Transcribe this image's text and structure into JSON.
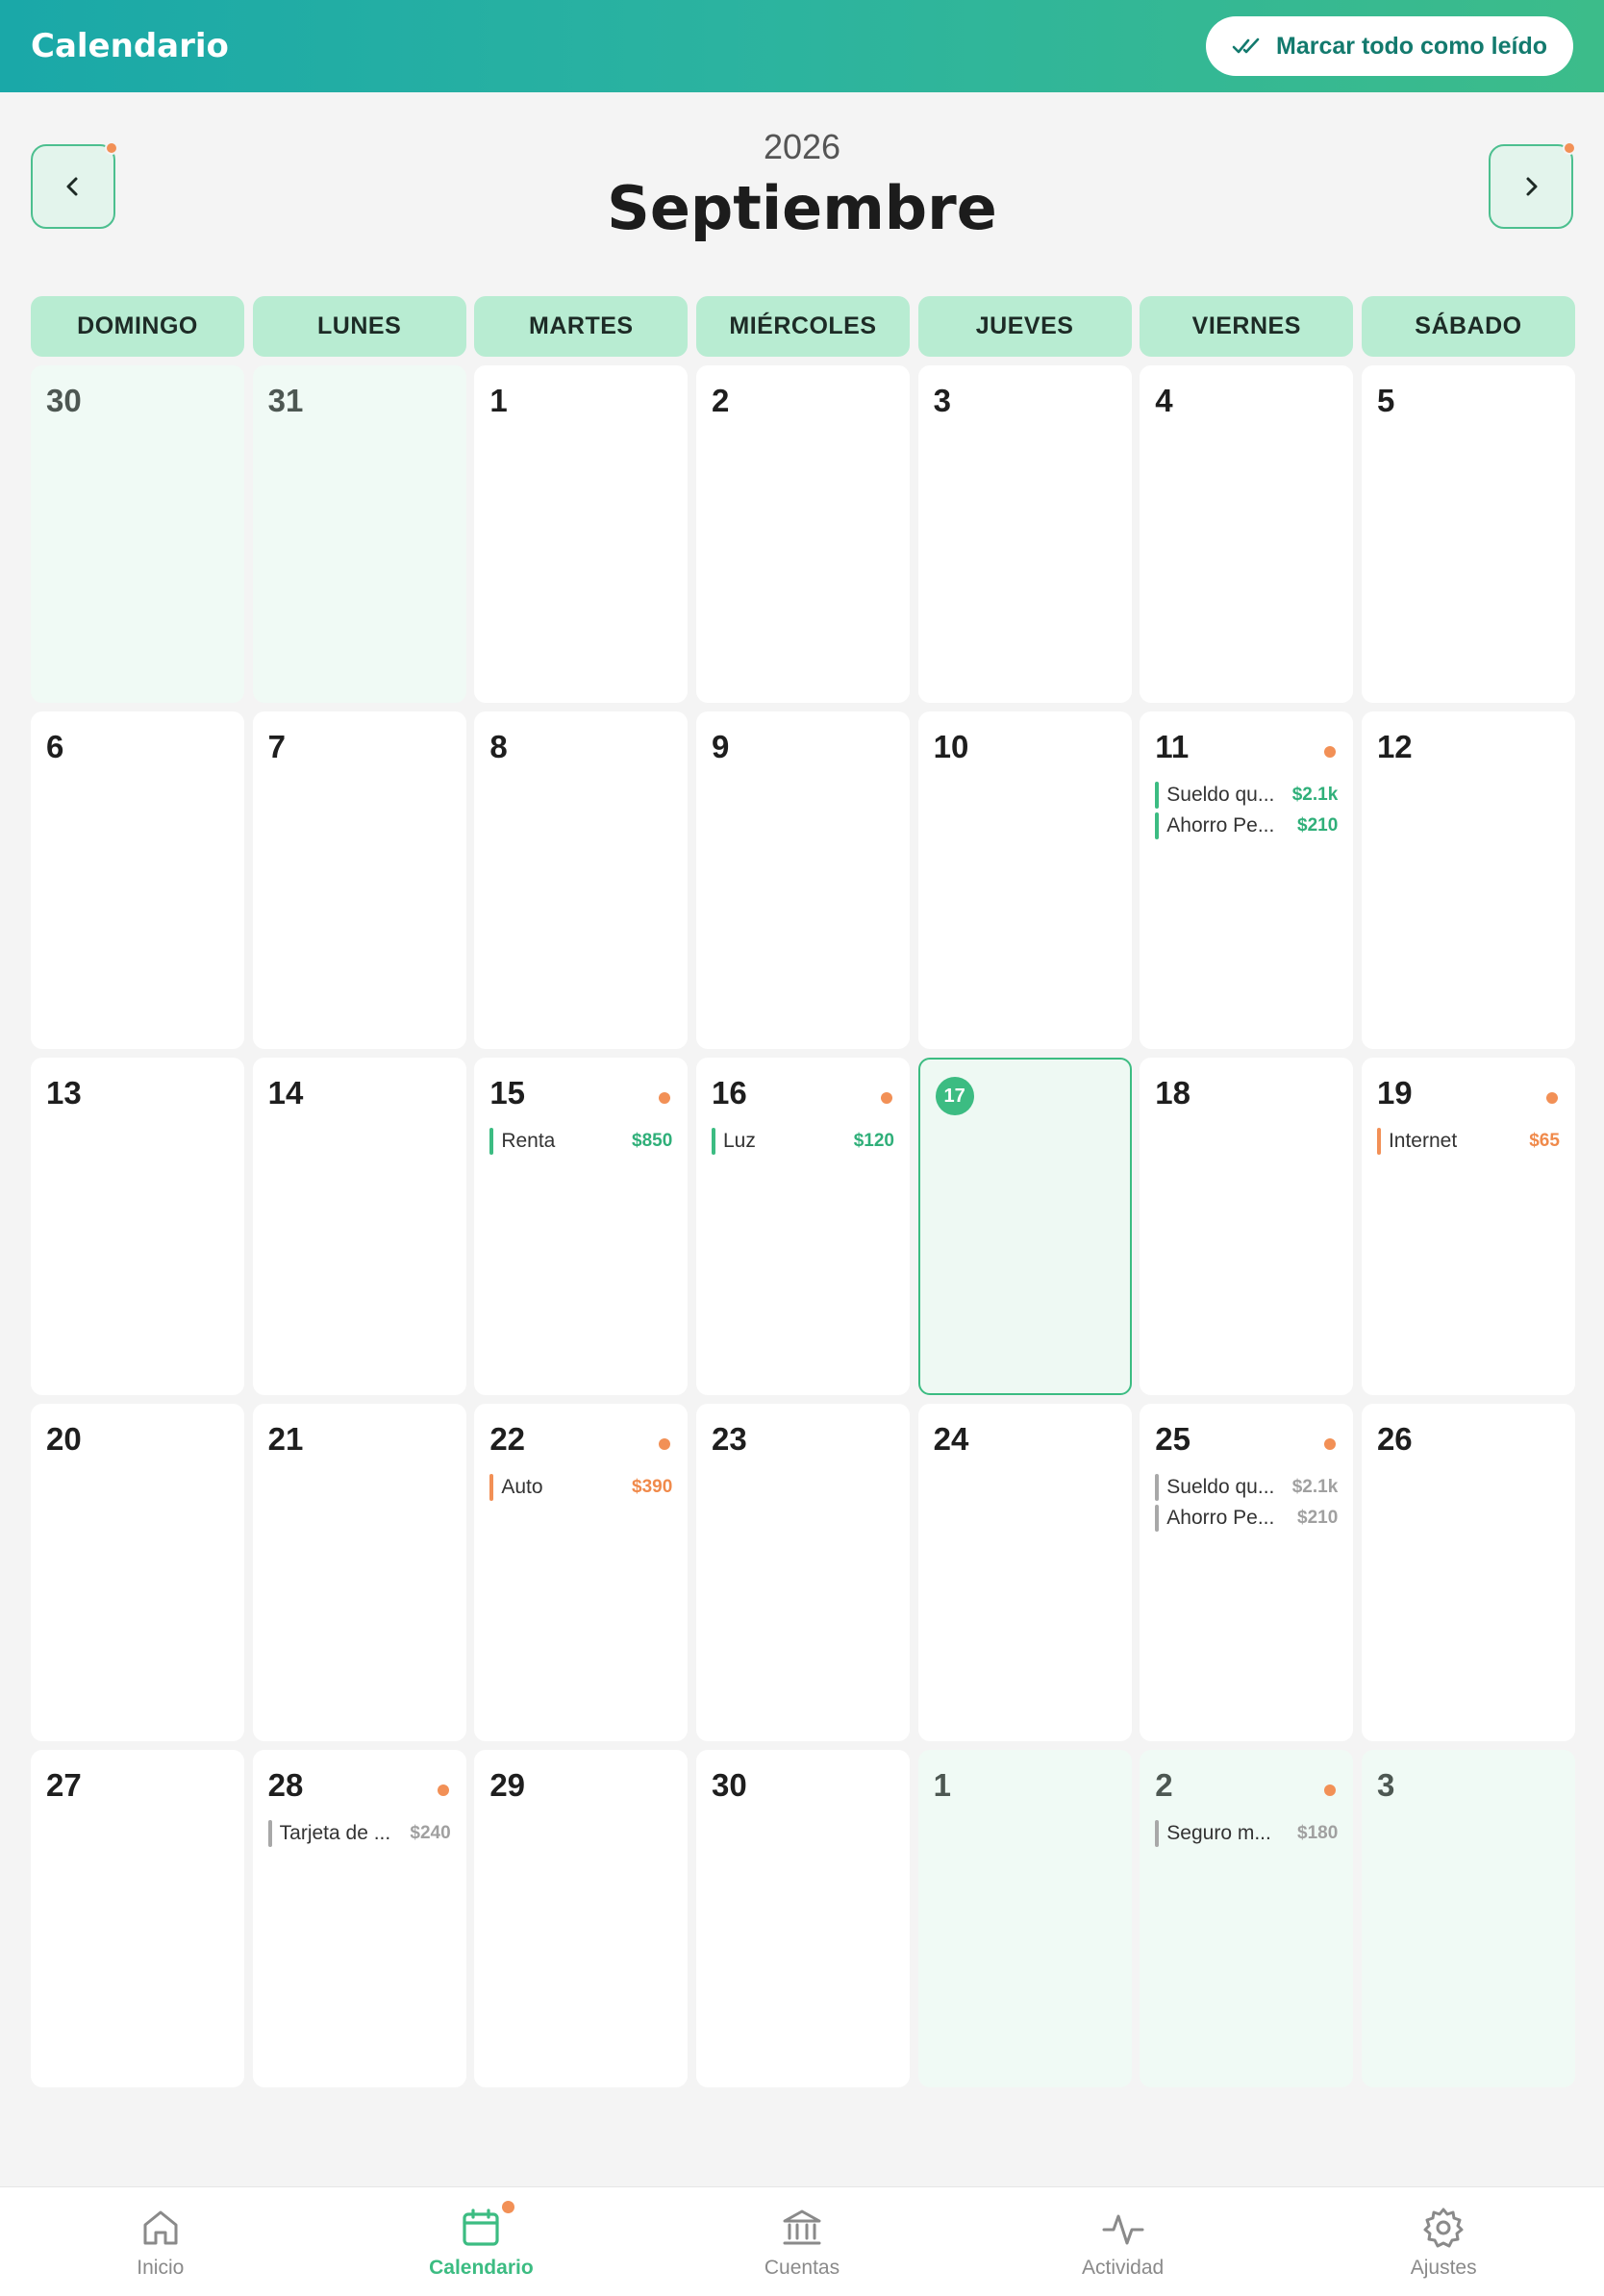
{
  "header": {
    "title": "Calendario",
    "mark_all_read": "Marcar todo como leído"
  },
  "month_nav": {
    "year": "2026",
    "month": "Septiembre",
    "prev_icon": "chevron-left-icon",
    "next_icon": "chevron-right-icon"
  },
  "weekdays": [
    "DOMINGO",
    "LUNES",
    "MARTES",
    "MIÉRCOLES",
    "JUEVES",
    "VIERNES",
    "SÁBADO"
  ],
  "days": [
    {
      "day": "30",
      "out": true
    },
    {
      "day": "31",
      "out": true
    },
    {
      "day": "1"
    },
    {
      "day": "2"
    },
    {
      "day": "3"
    },
    {
      "day": "4"
    },
    {
      "day": "5"
    },
    {
      "day": "6"
    },
    {
      "day": "7"
    },
    {
      "day": "8"
    },
    {
      "day": "9"
    },
    {
      "day": "10"
    },
    {
      "day": "11",
      "dot": true,
      "events": [
        {
          "label": "Sueldo qu...",
          "amount": "$2.1k",
          "bar": "#3cbc82",
          "amt": "#2faf79"
        },
        {
          "label": "Ahorro Pe...",
          "amount": "$210",
          "bar": "#3cbc82",
          "amt": "#2faf79"
        }
      ]
    },
    {
      "day": "12"
    },
    {
      "day": "13"
    },
    {
      "day": "14"
    },
    {
      "day": "15",
      "dot": true,
      "events": [
        {
          "label": "Renta",
          "amount": "$850",
          "bar": "#3cbc82",
          "amt": "#2faf79"
        }
      ]
    },
    {
      "day": "16",
      "dot": true,
      "events": [
        {
          "label": "Luz",
          "amount": "$120",
          "bar": "#3cbc82",
          "amt": "#2faf79"
        }
      ]
    },
    {
      "day": "17",
      "today": true
    },
    {
      "day": "18"
    },
    {
      "day": "19",
      "dot": true,
      "events": [
        {
          "label": "Internet",
          "amount": "$65",
          "bar": "#f29056",
          "amt": "#f08a4b"
        }
      ]
    },
    {
      "day": "20"
    },
    {
      "day": "21"
    },
    {
      "day": "22",
      "dot": true,
      "events": [
        {
          "label": "Auto",
          "amount": "$390",
          "bar": "#f29056",
          "amt": "#f08a4b"
        }
      ]
    },
    {
      "day": "23"
    },
    {
      "day": "24"
    },
    {
      "day": "25",
      "dot": true,
      "events": [
        {
          "label": "Sueldo qu...",
          "amount": "$2.1k",
          "bar": "#a8a8a8",
          "amt": "#a0a0a0"
        },
        {
          "label": "Ahorro Pe...",
          "amount": "$210",
          "bar": "#a8a8a8",
          "amt": "#a0a0a0"
        }
      ]
    },
    {
      "day": "26"
    },
    {
      "day": "27"
    },
    {
      "day": "28",
      "dot": true,
      "events": [
        {
          "label": "Tarjeta de ...",
          "amount": "$240",
          "bar": "#a8a8a8",
          "amt": "#a0a0a0"
        }
      ]
    },
    {
      "day": "29"
    },
    {
      "day": "30"
    },
    {
      "day": "1",
      "out": true
    },
    {
      "day": "2",
      "out": true,
      "dot": true,
      "events": [
        {
          "label": "Seguro m...",
          "amount": "$180",
          "bar": "#a8a8a8",
          "amt": "#a0a0a0"
        }
      ]
    },
    {
      "day": "3",
      "out": true
    }
  ],
  "bottom_nav": [
    {
      "label": "Inicio",
      "icon": "home-icon"
    },
    {
      "label": "Calendario",
      "icon": "calendar-icon",
      "active": true,
      "badge": true
    },
    {
      "label": "Cuentas",
      "icon": "bank-icon"
    },
    {
      "label": "Actividad",
      "icon": "activity-icon"
    },
    {
      "label": "Ajustes",
      "icon": "gear-icon"
    }
  ],
  "colors": {
    "accent": "#3cbc82",
    "warning": "#f29056",
    "weekday_bg": "#b8ecd2"
  }
}
